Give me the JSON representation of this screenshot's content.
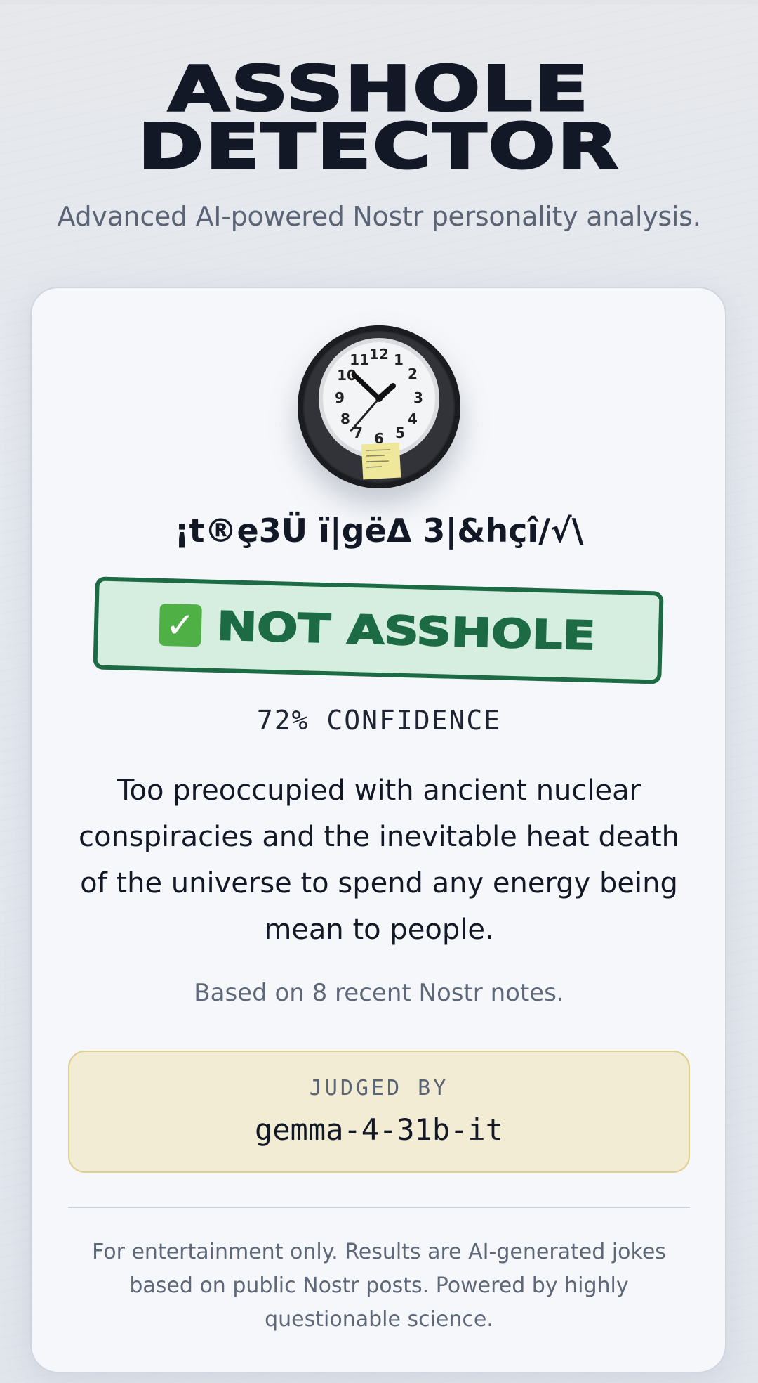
{
  "header": {
    "title_line1": "ASSHOLE",
    "title_line2": "DETECTOR",
    "subtitle": "Advanced AI-powered Nostr personality analysis."
  },
  "result": {
    "avatar_icon": "wall-clock-avatar",
    "user_name": "¡t®ȩ3Ü ï|gëΔ 3|&hçî/√\\",
    "verdict": {
      "emoji": "✅",
      "label": "NOT ASSHOLE"
    },
    "confidence": "72% CONFIDENCE",
    "description": "Too preoccupied with ancient nuclear conspiracies and the inevitable heat death of the universe to spend any energy being mean to people.",
    "notes_count": "Based on 8 recent Nostr notes.",
    "judge": {
      "label": "JUDGED BY",
      "model": "gemma-4-31b-it"
    },
    "disclaimer": "For entertainment only. Results are AI-generated jokes based on public Nostr posts. Powered by highly questionable science."
  },
  "colors": {
    "verdict_green": "#1c6b45",
    "verdict_bg": "#d5eee0",
    "judge_bg": "#f2ecd4",
    "judge_border": "#dfcf8f"
  }
}
